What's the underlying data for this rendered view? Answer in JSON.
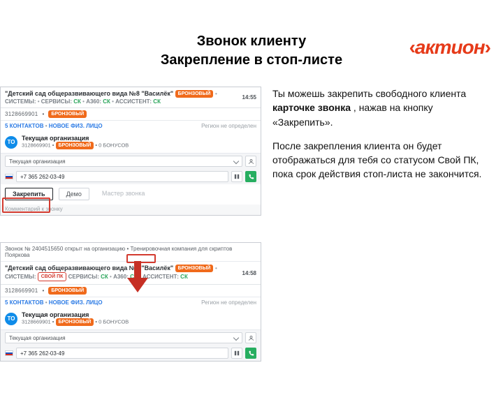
{
  "brand": {
    "left": "‹",
    "text": "актион",
    "right": "›"
  },
  "title": {
    "line1": "Звонок клиенту",
    "line2": "Закрепление в стоп-листе"
  },
  "shot1": {
    "head_prefix": "✱ ",
    "head_title": "\"Детский сад общеразвивающего вида №8 \"Василёк\"",
    "badge_bronze": "БРОНЗОВЫЙ",
    "systems": "СИСТЕМЫ:",
    "services": "СЕРВИСЫ:",
    "svc_ck1": "СК",
    "svc_a360": "А360:",
    "svc_ck2": "СК",
    "svc_assist": "АССИСТЕНТ:",
    "svc_ck3": "СК",
    "time": "14:55",
    "id": "3128669901",
    "contacts": "5 КОНТАКТОВ",
    "newfiz": "НОВОЕ ФИЗ. ЛИЦО",
    "region": "Регион не определен",
    "avatar": "ТО",
    "org": "Текущая организация",
    "bonuses": "0 БОНУСОВ",
    "sel_label": "Текущая организация",
    "phone": "+7 365 262-03-49",
    "tab_fix": "Закрепить",
    "tab_demo": "Демо",
    "tab_wizard": "Мастер звонка",
    "comment_label": "Комментарий к звонку"
  },
  "shot2": {
    "banner": "Звонок № 2404515650 открыт на организацию • Тренировочная компания для скриптов Пояркова",
    "head_title": "\"Детский сад общеразвивающего вида №8 \"Василёк\"",
    "badge_bronze": "БРОНЗОВЫЙ",
    "systems": "СИСТЕМЫ:",
    "own_pk": "СВОЙ ПК",
    "services": "СЕРВИСЫ:",
    "svc_ck1": "СК",
    "svc_a360": "А360:",
    "svc_ck2": "СК",
    "svc_assist": "АССИСТЕНТ:",
    "svc_ck3": "СК",
    "time": "14:58",
    "id": "3128669901",
    "contacts": "5 КОНТАКТОВ",
    "newfiz": "НОВОЕ ФИЗ. ЛИЦО",
    "region": "Регион не определен",
    "avatar": "ТО",
    "org": "Текущая организация",
    "bonuses": "0 БОНУСОВ",
    "sel_label": "Текущая организация",
    "phone": "+7 365 262-03-49"
  },
  "copy": {
    "p1a": "Ты можешь закрепить свободного клиента  ",
    "p1b": "карточке звонка ",
    "p1c": ", нажав на кнопку «Закрепить».",
    "p2": "После закрепления клиента он будет отображаться для тебя со статусом Свой ПК, пока срок действия стоп-листа не закончится."
  }
}
